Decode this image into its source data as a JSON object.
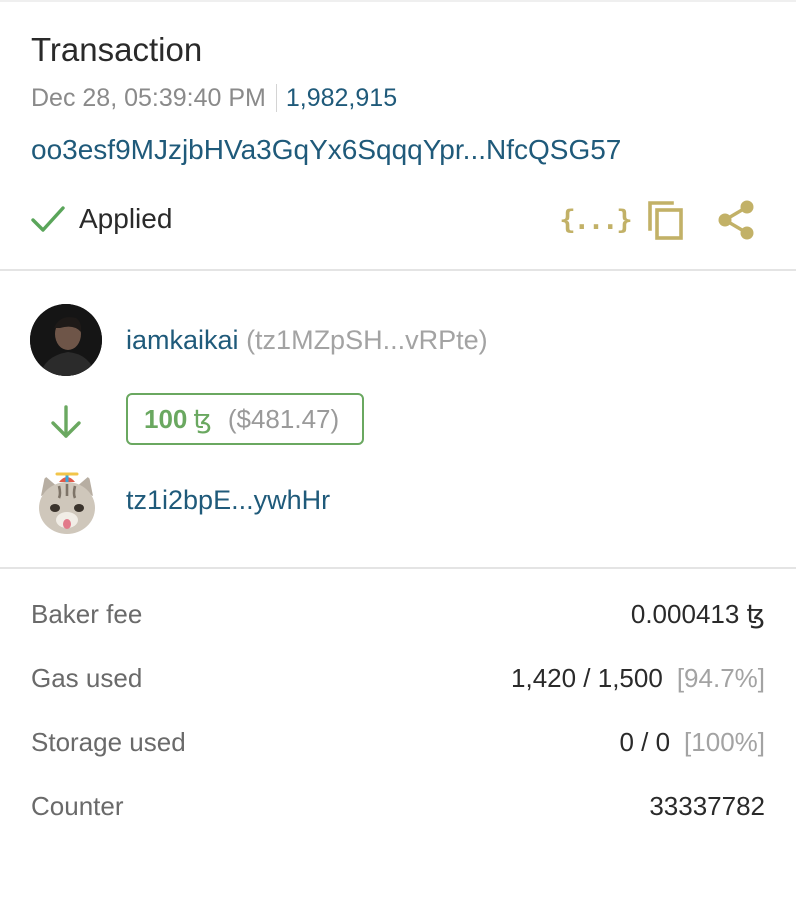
{
  "header": {
    "title": "Transaction",
    "timestamp": "Dec 28, 05:39:40 PM",
    "block": "1,982,915",
    "hash": "oo3esf9MJzjbHVa3GqYx6SqqqYpr...NfcQSG57"
  },
  "status": {
    "label": "Applied",
    "icon": "check-icon",
    "color": "#5aa55a"
  },
  "actions": {
    "json_icon": "{...}",
    "copy_icon": "copy-icon",
    "share_icon": "share-icon",
    "accent_color": "#c2b167"
  },
  "transfer": {
    "sender_name": "iamkaikai",
    "sender_address": "(tz1MZpSH...vRPte)",
    "amount": "100",
    "currency_symbol": "ꜩ",
    "amount_usd": "($481.47)",
    "target_address": "tz1i2bpE...ywhHr",
    "accent_color": "#6aa860"
  },
  "details": [
    {
      "label": "Baker fee",
      "value": "0.000413 ꜩ",
      "extra": ""
    },
    {
      "label": "Gas used",
      "value": "1,420 / 1,500",
      "extra": "[94.7%]"
    },
    {
      "label": "Storage used",
      "value": "0 / 0",
      "extra": "[100%]"
    },
    {
      "label": "Counter",
      "value": "33337782",
      "extra": ""
    }
  ]
}
